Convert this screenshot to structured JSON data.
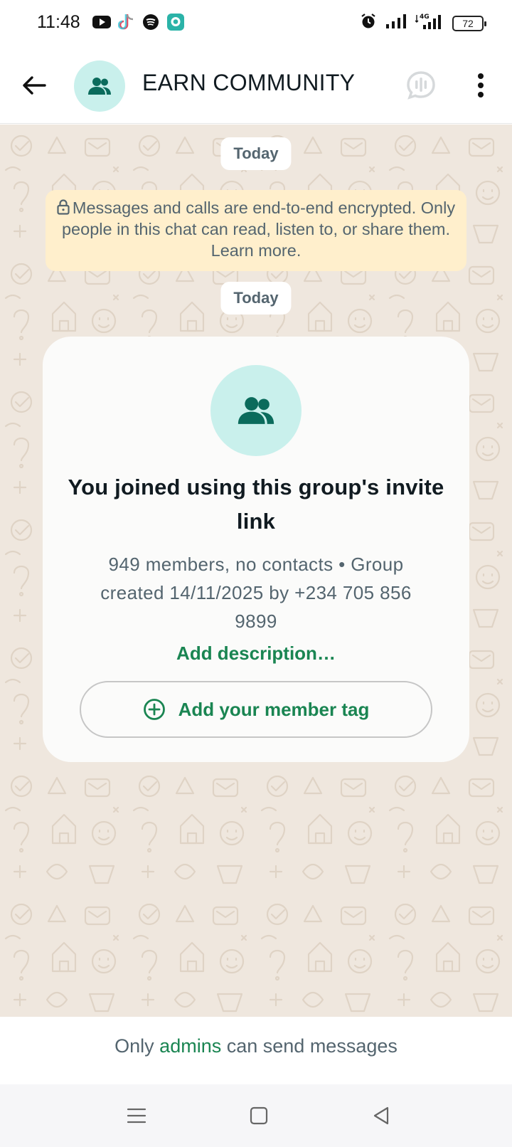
{
  "status_bar": {
    "time": "11:48",
    "network": "4G",
    "battery": "72",
    "left_icons": [
      "youtube-icon",
      "tiktok-icon",
      "spotify-icon",
      "chat-app-icon"
    ],
    "right_icons": [
      "alarm-icon",
      "signal-icon",
      "signal-4g-icon",
      "battery-icon"
    ]
  },
  "header": {
    "title": "EARN COMMUNITY",
    "icons": [
      "back-arrow-icon",
      "group-avatar-icon",
      "voice-chat-icon",
      "more-vert-icon"
    ]
  },
  "chat": {
    "date_pill_1": "Today",
    "encryption_notice": "Messages and calls are end-to-end encrypted. Only people in this chat can read, listen to, or share them. Learn more.",
    "date_pill_2": "Today",
    "info_card": {
      "heading": "You joined using this group's invite link",
      "meta": "949 members, no contacts • Group created 14/11/2025 by +234 705 856 9899",
      "add_description": "Add description…",
      "member_tag_button": "Add your member tag"
    }
  },
  "footer": {
    "prefix": "Only",
    "link": "admins",
    "suffix": "can send messages"
  },
  "colors": {
    "accent_green": "#1a8552",
    "avatar_bg": "#c9f0ec",
    "avatar_fg": "#0b6b5c",
    "chat_bg": "#efe7de",
    "notice_bg": "#ffefcc"
  }
}
